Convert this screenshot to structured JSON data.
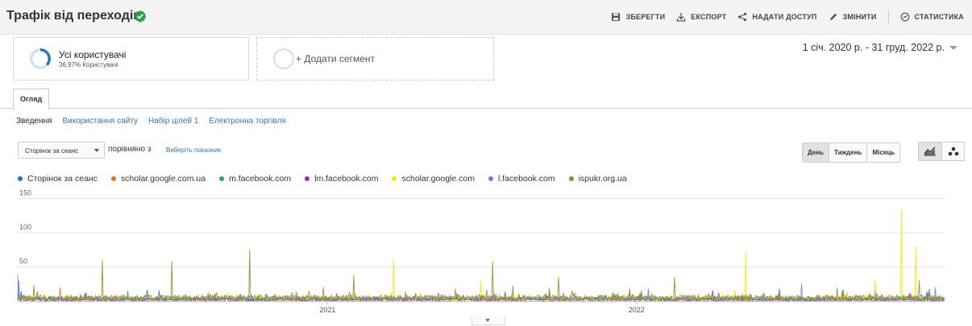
{
  "header": {
    "title": "Трафік від переходів",
    "actions": {
      "save": "ЗБЕРЕГТИ",
      "export": "ЕКСПОРТ",
      "share": "НАДАТИ ДОСТУП",
      "edit": "ЗМІНИТИ",
      "stats": "СТАТИСТИКА"
    }
  },
  "segments": {
    "active": {
      "title": "Усі користувачі",
      "subtitle": "36,97% Користувачі",
      "share": 0.3697,
      "ring_color": "#1f77b4"
    },
    "add_label": "+ Додати сегмент"
  },
  "date_range": "1 січ. 2020 р. - 31 груд. 2022 р.",
  "tabs": {
    "active": "Огляд"
  },
  "subtabs": [
    "Зведення",
    "Використання сайту",
    "Набір цілей 1",
    "Електронна торгівля"
  ],
  "controls": {
    "metric": "Сторінок за сеанс",
    "compare_label": "порівняно з",
    "pick_metric": "Виберіть показник",
    "granularity": [
      "День",
      "Тиждень",
      "Місяць"
    ],
    "granularity_selected": "День",
    "view_icons": [
      "line-chart-icon",
      "scatter-icon"
    ]
  },
  "chart_data": {
    "type": "line",
    "x_range": [
      "2020-01-01",
      "2022-12-31"
    ],
    "x_ticks": [
      "2021",
      "2022"
    ],
    "y_ticks": [
      50,
      100,
      150
    ],
    "ylim": [
      0,
      160
    ],
    "grid": true,
    "legend_position": "top-left",
    "series": [
      {
        "name": "Сторінок за сеанс",
        "color": "#1a73c8",
        "typical": 4,
        "peaks": [
          {
            "date": "2020-01-02",
            "value": 30
          },
          {
            "date": "2021-04-15",
            "value": 10
          },
          {
            "date": "2022-04-08",
            "value": 12
          },
          {
            "date": "2022-10-10",
            "value": 15
          }
        ]
      },
      {
        "name": "scholar.google.com.ua",
        "color": "#e8710a",
        "typical": 3,
        "peaks": [
          {
            "date": "2020-02-20",
            "value": 20
          },
          {
            "date": "2020-12-10",
            "value": 15
          },
          {
            "date": "2021-06-01",
            "value": 18
          },
          {
            "date": "2022-09-01",
            "value": 14
          }
        ]
      },
      {
        "name": "m.facebook.com",
        "color": "#34a853",
        "typical": 3,
        "peaks": [
          {
            "date": "2020-05-10",
            "value": 15
          },
          {
            "date": "2021-09-20",
            "value": 12
          },
          {
            "date": "2022-12-10",
            "value": 14
          }
        ]
      },
      {
        "name": "lm.facebook.com",
        "color": "#9c27b0",
        "typical": 2,
        "peaks": [
          {
            "date": "2020-01-05",
            "value": 14
          },
          {
            "date": "2022-04-01",
            "value": 16
          },
          {
            "date": "2022-11-20",
            "value": 12
          }
        ]
      },
      {
        "name": "scholar.google.com",
        "color": "#f0e60a",
        "typical": 4,
        "peaks": [
          {
            "date": "2021-03-20",
            "value": 60
          },
          {
            "date": "2021-07-01",
            "value": 30
          },
          {
            "date": "2022-05-10",
            "value": 72
          },
          {
            "date": "2022-10-10",
            "value": 30
          },
          {
            "date": "2022-11-10",
            "value": 133
          },
          {
            "date": "2022-11-27",
            "value": 80
          }
        ]
      },
      {
        "name": "l.facebook.com",
        "color": "#7b74e8",
        "typical": 3,
        "peaks": [
          {
            "date": "2020-01-01",
            "value": 38
          },
          {
            "date": "2022-01-15",
            "value": 18
          },
          {
            "date": "2022-07-15",
            "value": 25
          },
          {
            "date": "2022-12-20",
            "value": 20
          }
        ]
      },
      {
        "name": "ispukr.org.ua",
        "color": "#8c8c2e",
        "typical": 5,
        "peaks": [
          {
            "date": "2020-01-20",
            "value": 23
          },
          {
            "date": "2020-04-10",
            "value": 60
          },
          {
            "date": "2020-07-01",
            "value": 58
          },
          {
            "date": "2020-10-01",
            "value": 75
          },
          {
            "date": "2021-02-01",
            "value": 38
          },
          {
            "date": "2021-07-15",
            "value": 58
          },
          {
            "date": "2021-10-01",
            "value": 35
          },
          {
            "date": "2022-02-15",
            "value": 35
          },
          {
            "date": "2022-12-01",
            "value": 30
          }
        ]
      }
    ]
  }
}
